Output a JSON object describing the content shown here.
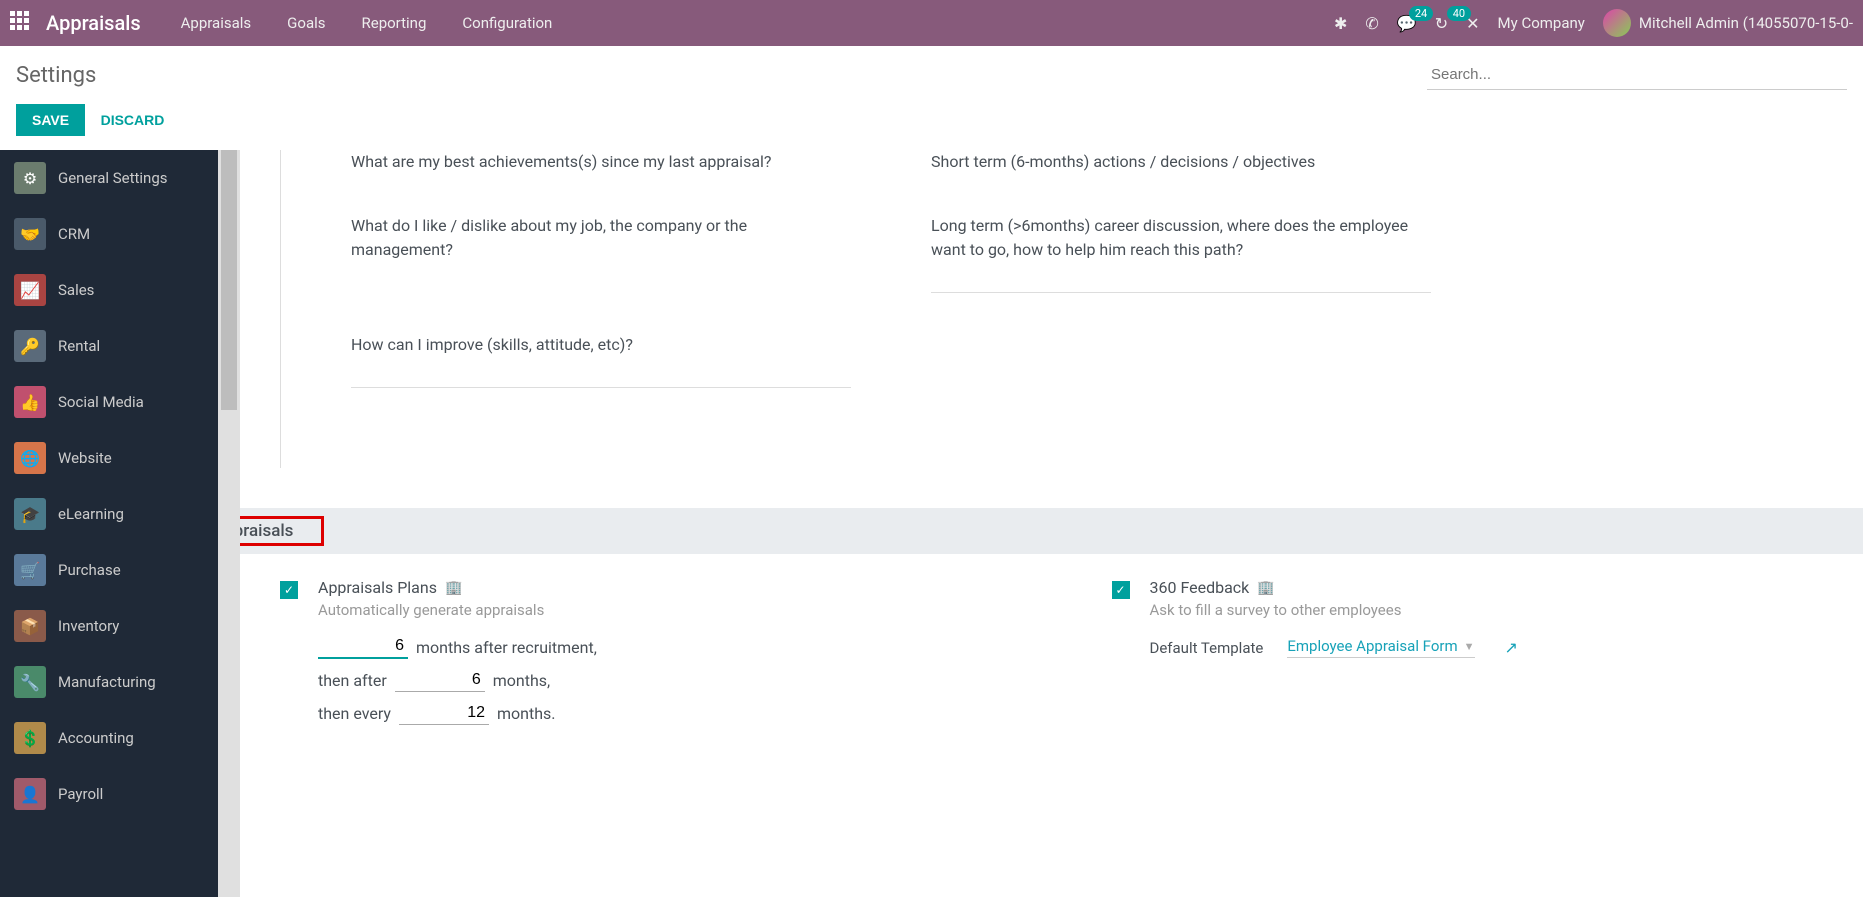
{
  "topbar": {
    "brand": "Appraisals",
    "nav": [
      "Appraisals",
      "Goals",
      "Reporting",
      "Configuration"
    ],
    "msg_count": "24",
    "activity_count": "40",
    "company": "My Company",
    "user": "Mitchell Admin (14055070-15-0-"
  },
  "subhead": {
    "title": "Settings",
    "search_placeholder": "Search..."
  },
  "actions": {
    "save": "SAVE",
    "discard": "DISCARD"
  },
  "sidebar": [
    {
      "label": "General Settings",
      "color": "#6b7c6e"
    },
    {
      "label": "CRM",
      "color": "#4a5a6a"
    },
    {
      "label": "Sales",
      "color": "#a94442"
    },
    {
      "label": "Rental",
      "color": "#5a6a7a"
    },
    {
      "label": "Social Media",
      "color": "#c0506e"
    },
    {
      "label": "Website",
      "color": "#d6754a"
    },
    {
      "label": "eLearning",
      "color": "#4a7a8a"
    },
    {
      "label": "Purchase",
      "color": "#5a7a9a"
    },
    {
      "label": "Inventory",
      "color": "#8a5a4a"
    },
    {
      "label": "Manufacturing",
      "color": "#4a8a6a"
    },
    {
      "label": "Accounting",
      "color": "#b08a4a"
    },
    {
      "label": "Payroll",
      "color": "#a05a6a"
    }
  ],
  "questions": {
    "left": [
      "What are my best achievements(s) since my last appraisal?",
      "What do I like / dislike about my job, the company or the management?",
      "How can I improve (skills, attitude, etc)?"
    ],
    "right": [
      "Short term (6-months) actions / decisions / objectives",
      "Long term (>6months) career discussion, where does the employee want to go, how to help him reach this path?"
    ]
  },
  "section": {
    "title": "Appraisals"
  },
  "plans": {
    "title": "Appraisals Plans",
    "sub": "Automatically generate appraisals",
    "v1": "6",
    "t1": "months after recruitment,",
    "l2": "then after",
    "v2": "6",
    "t2": "months,",
    "l3": "then every",
    "v3": "12",
    "t3": "months."
  },
  "feedback": {
    "title": "360 Feedback",
    "sub": "Ask to fill a survey to other employees",
    "def_label": "Default Template",
    "def_val": "Employee Appraisal Form"
  }
}
